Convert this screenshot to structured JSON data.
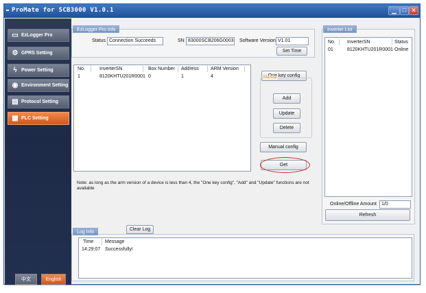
{
  "window": {
    "title": "ProMate for SCB3000 V1.0.1",
    "minimize_label": "▁",
    "maximize_label": "□",
    "close_label": "✕"
  },
  "sidebar": {
    "items": [
      {
        "label": "EzLogger Pro",
        "icon": "window-icon",
        "glyph": "▭",
        "active": false
      },
      {
        "label": "GPRS Setting",
        "icon": "gear-icon",
        "glyph": "⚙",
        "active": false
      },
      {
        "label": "Power Setting",
        "icon": "lightning-icon",
        "glyph": "ϟ",
        "active": false
      },
      {
        "label": "Environment Setting",
        "icon": "power-circle-icon",
        "glyph": "◉",
        "active": false
      },
      {
        "label": "Protocol Setting",
        "icon": "document-icon",
        "glyph": "▤",
        "active": false
      },
      {
        "label": "PLC Setting",
        "icon": "plc-icon",
        "glyph": "▦",
        "active": true
      }
    ],
    "lang_chinese": "中文",
    "lang_english": "English"
  },
  "info": {
    "title": "EzLogger Pro Info",
    "status_label": "Status",
    "status_value": "Connection Succeeds",
    "sn_label": "SN",
    "sn_value": "83000SCB206G0003",
    "software_label": "Software Version",
    "software_value": "V1.01",
    "set_time": "Set Time"
  },
  "device_table": {
    "headers": [
      "No.",
      "InverterSN",
      "Box Number",
      "Address",
      "ARM Version"
    ],
    "rows": [
      [
        "1",
        "8120KHTU201R0001",
        "0",
        "1",
        "4"
      ]
    ]
  },
  "actions": {
    "one_key_config": "One key config",
    "manual_label": "Manual",
    "add": "Add",
    "update": "Update",
    "delete": "Delete",
    "manual_config": "Manual config",
    "get": "Get"
  },
  "note": "Note: as long as the arm version of a device is less than 4, the \"One key config\", \"Add\" and \"Update\" functions are not available",
  "inverter_list": {
    "title": "Inverter List",
    "headers": [
      "No.",
      "InverterSN",
      "Status"
    ],
    "rows": [
      [
        "01",
        "8120KHTU201R0001",
        "Online"
      ]
    ],
    "amount_label": "Online/Offline Amount",
    "amount_value": "1/0",
    "refresh": "Refresh"
  },
  "log": {
    "title": "Log Info",
    "clear": "Clear Log",
    "headers": [
      "Time",
      "Message"
    ],
    "rows": [
      [
        "14:29:07",
        "Successfully!"
      ]
    ]
  },
  "colors": {
    "accent_orange": "#d8541c",
    "title_blue": "#1f4f96",
    "highlight_red": "#c0302a",
    "manual_orange": "#e08020"
  }
}
